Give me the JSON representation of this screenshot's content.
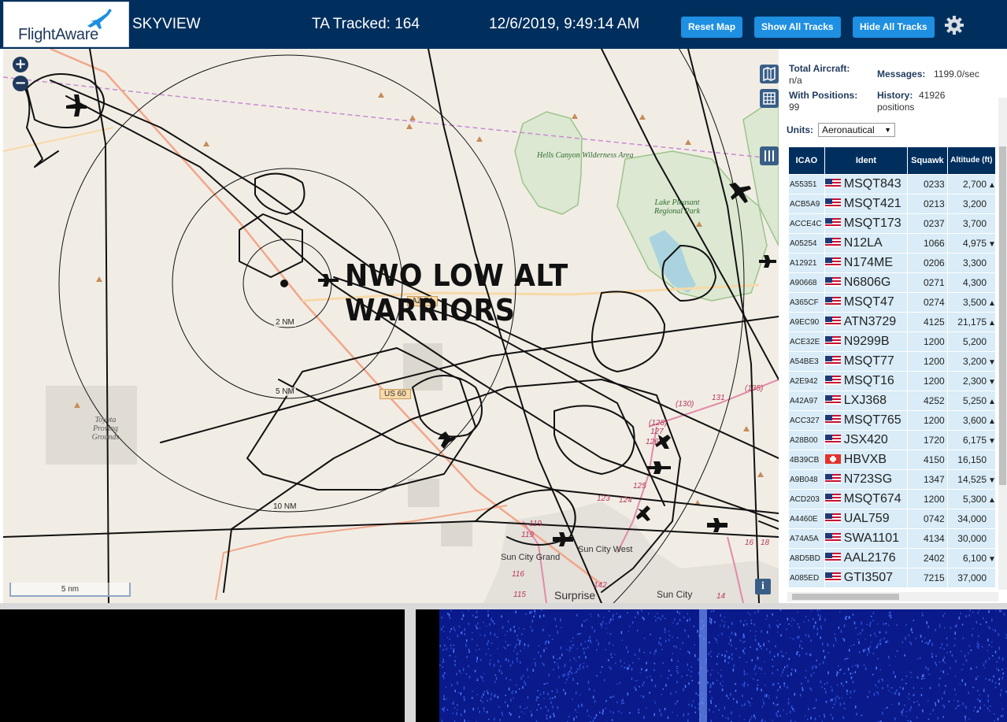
{
  "header": {
    "logo_text": "FlightAware",
    "app_name": "SKYVIEW",
    "tracked": "TA Tracked: 164",
    "datetime": "12/6/2019, 9:49:14 AM",
    "buttons": {
      "reset": "Reset Map",
      "show_all": "Show All Tracks",
      "hide_all": "Hide All Tracks"
    },
    "settings_icon": "gear-icon"
  },
  "map": {
    "overlay_title": "NWO LOW ALT WARRIORS",
    "zoom_in": "+",
    "zoom_out": "−",
    "ring_labels": [
      "2 NM",
      "5 NM",
      "10 NM"
    ],
    "road_labels": [
      "AZ 74",
      "US 60"
    ],
    "park_labels": [
      "Hells Canyon Wilderness Area",
      "Lake Pleasant Regional Park"
    ],
    "place_labels": [
      "Toyota Proving Grounds",
      "Sun City Grand",
      "Sun City West",
      "Surprise",
      "Sun City"
    ],
    "route_numbers": [
      "(135)",
      "(130)",
      "131",
      "(128)",
      "127",
      "126",
      "125",
      "124",
      "123",
      "119",
      "119",
      "116",
      "115",
      "142",
      "14",
      "16",
      "18"
    ],
    "scale_label": "5 nm",
    "info": "i",
    "controls": [
      "map-layers-icon",
      "grid-icon",
      "columns-icon"
    ]
  },
  "panel": {
    "stats": {
      "total_aircraft_label": "Total Aircraft:",
      "total_aircraft_value": "n/a",
      "messages_label": "Messages:",
      "messages_value": "1199.0/sec",
      "with_positions_label": "With Positions:",
      "with_positions_value": "99",
      "history_label": "History:",
      "history_value": "41926",
      "history_unit": "positions"
    },
    "units_label": "Units:",
    "units_value": "Aeronautical",
    "columns": [
      "ICAO",
      "Ident",
      "Squawk",
      "Altitude (ft)"
    ],
    "rows": [
      {
        "icao": "A55351",
        "flag": "us",
        "ident": "MSQT843",
        "squawk": "0233",
        "alt": "2,700",
        "trend": "▲"
      },
      {
        "icao": "ACB5A9",
        "flag": "us",
        "ident": "MSQT421",
        "squawk": "0213",
        "alt": "3,200",
        "trend": ""
      },
      {
        "icao": "ACCE4C",
        "flag": "us",
        "ident": "MSQT173",
        "squawk": "0237",
        "alt": "3,700",
        "trend": ""
      },
      {
        "icao": "A05254",
        "flag": "us",
        "ident": "N12LA",
        "squawk": "1066",
        "alt": "4,975",
        "trend": "▼"
      },
      {
        "icao": "A12921",
        "flag": "us",
        "ident": "N174ME",
        "squawk": "0206",
        "alt": "3,300",
        "trend": ""
      },
      {
        "icao": "A90668",
        "flag": "us",
        "ident": "N6806G",
        "squawk": "0271",
        "alt": "4,300",
        "trend": ""
      },
      {
        "icao": "A365CF",
        "flag": "us",
        "ident": "MSQT47",
        "squawk": "0274",
        "alt": "3,500",
        "trend": "▲"
      },
      {
        "icao": "A9EC90",
        "flag": "us",
        "ident": "ATN3729",
        "squawk": "4125",
        "alt": "21,175",
        "trend": "▲"
      },
      {
        "icao": "ACE32E",
        "flag": "us",
        "ident": "N9299B",
        "squawk": "1200",
        "alt": "5,200",
        "trend": ""
      },
      {
        "icao": "A54BE3",
        "flag": "us",
        "ident": "MSQT77",
        "squawk": "1200",
        "alt": "3,200",
        "trend": "▼"
      },
      {
        "icao": "A2E942",
        "flag": "us",
        "ident": "MSQT16",
        "squawk": "1200",
        "alt": "2,300",
        "trend": "▼"
      },
      {
        "icao": "A42A97",
        "flag": "us",
        "ident": "LXJ368",
        "squawk": "4252",
        "alt": "5,250",
        "trend": "▲"
      },
      {
        "icao": "ACC327",
        "flag": "us",
        "ident": "MSQT765",
        "squawk": "1200",
        "alt": "3,600",
        "trend": "▲"
      },
      {
        "icao": "A28B00",
        "flag": "us",
        "ident": "JSX420",
        "squawk": "1720",
        "alt": "6,175",
        "trend": "▼"
      },
      {
        "icao": "4B39CB",
        "flag": "ch",
        "ident": "HBVXB",
        "squawk": "4150",
        "alt": "16,150",
        "trend": ""
      },
      {
        "icao": "A9B048",
        "flag": "us",
        "ident": "N723SG",
        "squawk": "1347",
        "alt": "14,525",
        "trend": "▼"
      },
      {
        "icao": "ACD203",
        "flag": "us",
        "ident": "MSQT674",
        "squawk": "1200",
        "alt": "5,300",
        "trend": "▲"
      },
      {
        "icao": "A4460E",
        "flag": "us",
        "ident": "UAL759",
        "squawk": "0742",
        "alt": "34,000",
        "trend": ""
      },
      {
        "icao": "A74A5A",
        "flag": "us",
        "ident": "SWA1101",
        "squawk": "4134",
        "alt": "30,000",
        "trend": ""
      },
      {
        "icao": "A8D5BD",
        "flag": "us",
        "ident": "AAL2176",
        "squawk": "2402",
        "alt": "6,100",
        "trend": "▼"
      },
      {
        "icao": "A085ED",
        "flag": "us",
        "ident": "GTI3507",
        "squawk": "7215",
        "alt": "37,000",
        "trend": ""
      }
    ]
  },
  "colors": {
    "header_bg": "#002f5d",
    "button_bg": "#1e8fe1",
    "row_bg": "#d9ecf7",
    "map_bg": "#f1ede5",
    "waterfall_bg": "#000000"
  }
}
